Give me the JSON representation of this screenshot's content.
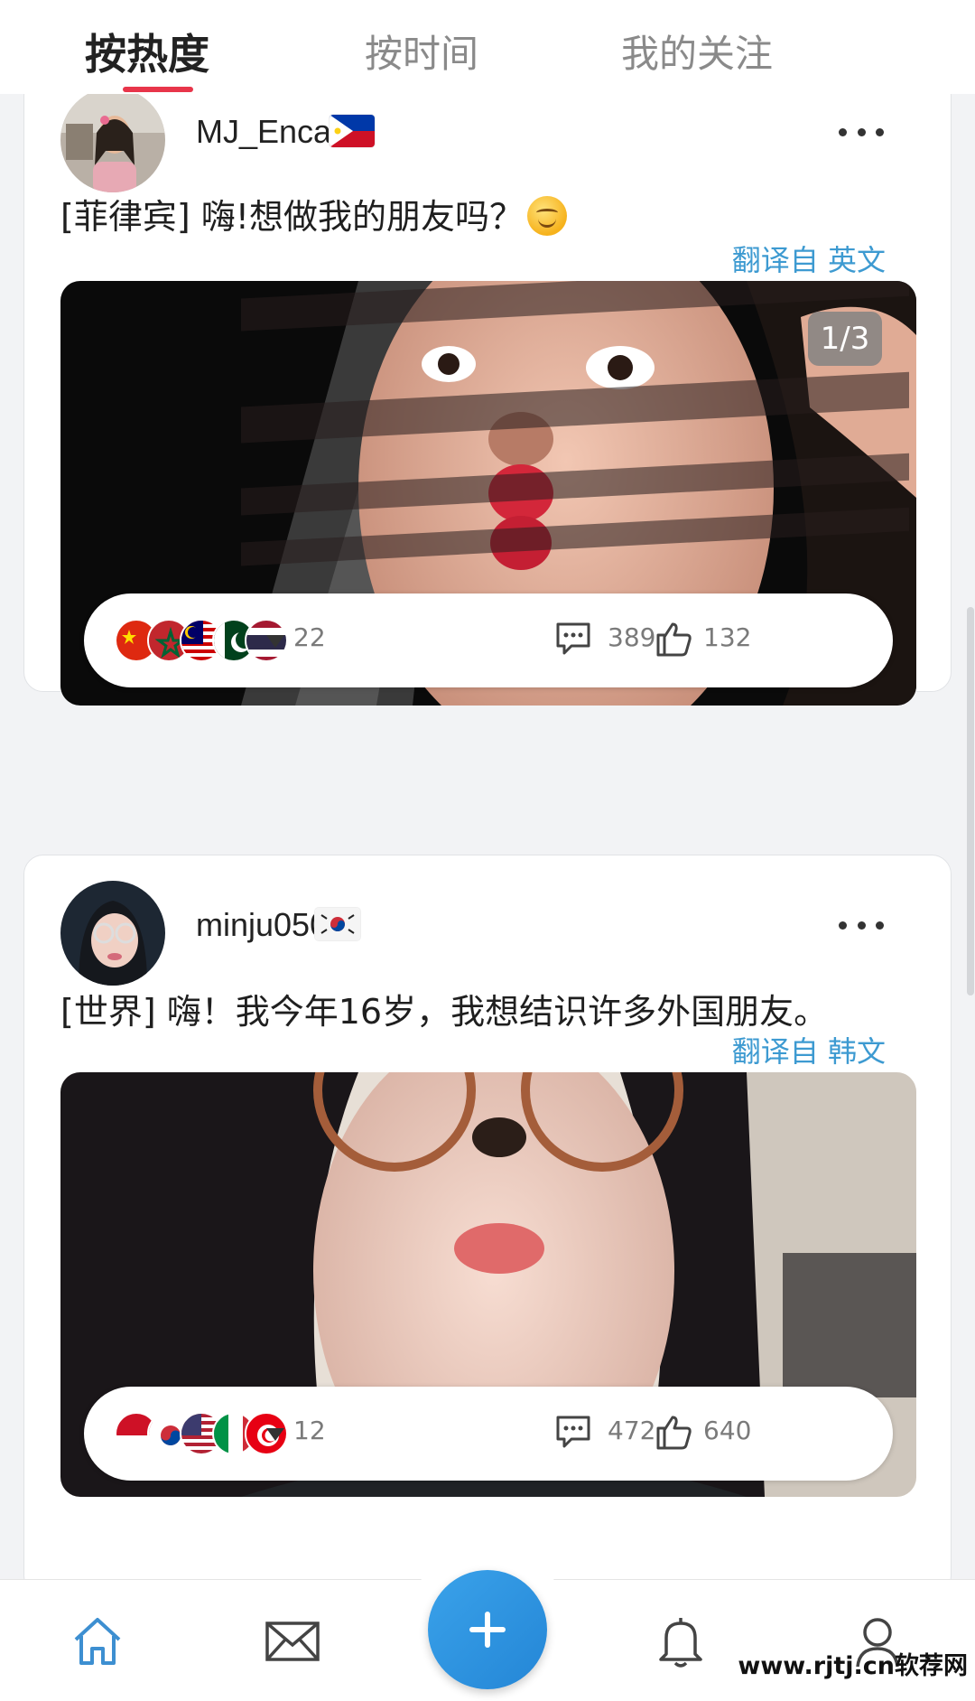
{
  "tabs": [
    {
      "label": "按热度",
      "active": true
    },
    {
      "label": "按时间",
      "active": false
    },
    {
      "label": "我的关注",
      "active": false
    }
  ],
  "posts": [
    {
      "username": "MJ_Encabo",
      "country_flag": "philippines-flag",
      "text": "[菲律宾] 嗨!想做我的朋友吗？",
      "emoji": "smiling-face-emoji",
      "translate_prefix": "翻译自",
      "translate_lang": "英文",
      "photo_counter": "1/3",
      "reaction_flags": [
        "china",
        "morocco",
        "malaysia",
        "pakistan",
        "thailand"
      ],
      "flag_count": "22",
      "comments": "389",
      "likes": "132"
    },
    {
      "username": "minju0501",
      "country_flag": "south-korea-flag",
      "text": "[世界] 嗨！我今年16岁，我想结识许多外国朋友。",
      "translate_prefix": "翻译自",
      "translate_lang": "韩文",
      "reaction_flags": [
        "indonesia",
        "south-korea",
        "usa",
        "italy",
        "tunisia"
      ],
      "flag_count": "12",
      "comments": "472",
      "likes": "640"
    }
  ],
  "bottom_nav": [
    "home-icon",
    "mail-icon",
    "add-icon",
    "bell-icon",
    "profile-icon"
  ],
  "watermark": "www.rjtj.cn软荐网",
  "colors": {
    "accent_red": "#e8354a",
    "link_blue": "#3d9ad1",
    "fab_blue": "#2a8fdc"
  }
}
